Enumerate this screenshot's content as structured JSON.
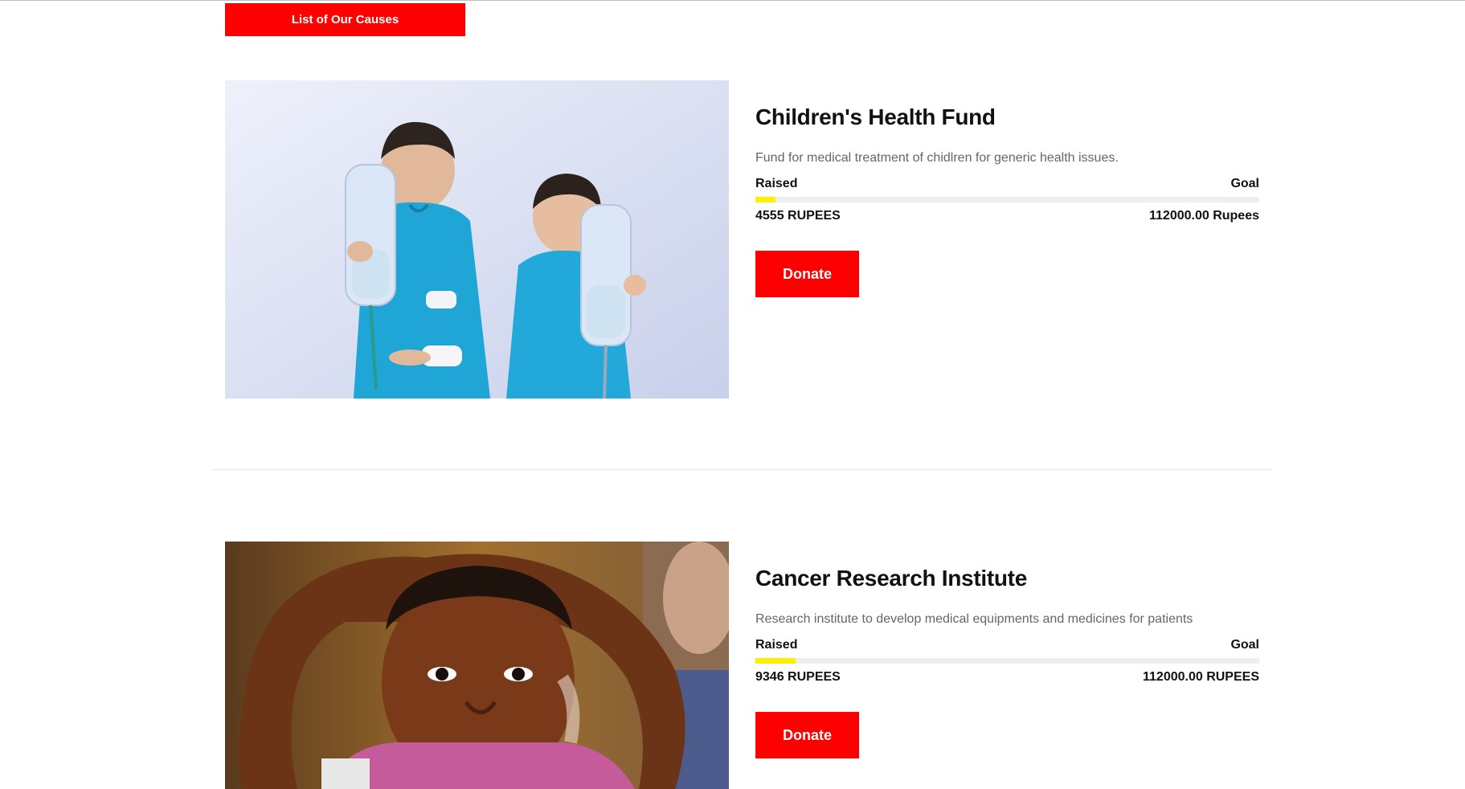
{
  "header": {
    "causes_button_label": "List of Our Causes"
  },
  "causes": [
    {
      "title": "Children's Health Fund",
      "description": "Fund for medical treatment of chidlren for generic health issues.",
      "raised_label": "Raised",
      "goal_label": "Goal",
      "raised_amount": "4555 RUPEES",
      "goal_amount": "112000.00 Rupees",
      "progress_fraction": 0.04,
      "donate_label": "Donate"
    },
    {
      "title": "Cancer Research Institute",
      "description": "Research institute to develop medical equipments and medicines for patients",
      "raised_label": "Raised",
      "goal_label": "Goal",
      "raised_amount": "9346 RUPEES",
      "goal_amount": "112000.00 RUPEES",
      "progress_fraction": 0.08,
      "donate_label": "Donate"
    }
  ],
  "colors": {
    "accent": "#ff0000",
    "progress": "#ffef00",
    "track": "#eeeeee"
  }
}
